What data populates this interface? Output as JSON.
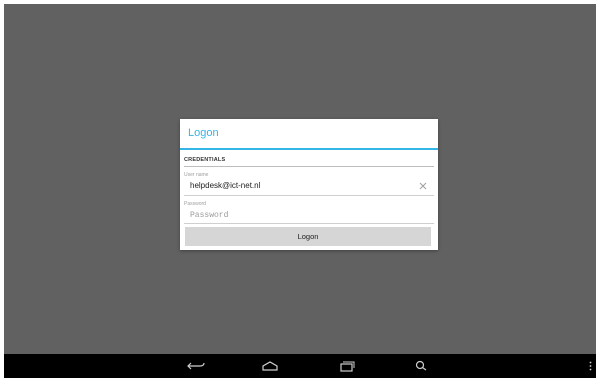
{
  "dialog": {
    "title": "Logon",
    "section_header": "CREDENTIALS",
    "username": {
      "label": "User name",
      "value": "helpdesk@ict-net.nl"
    },
    "password": {
      "label": "Password",
      "placeholder": "Password",
      "value": ""
    },
    "logon_button": "Logon"
  },
  "navbar": {
    "icons": [
      "back-icon",
      "home-icon",
      "recent-apps-icon",
      "search-icon",
      "menu-icon"
    ]
  },
  "colors": {
    "accent": "#33b5e5",
    "background": "#616161",
    "navbar": "#000000",
    "button": "#d6d6d6"
  }
}
